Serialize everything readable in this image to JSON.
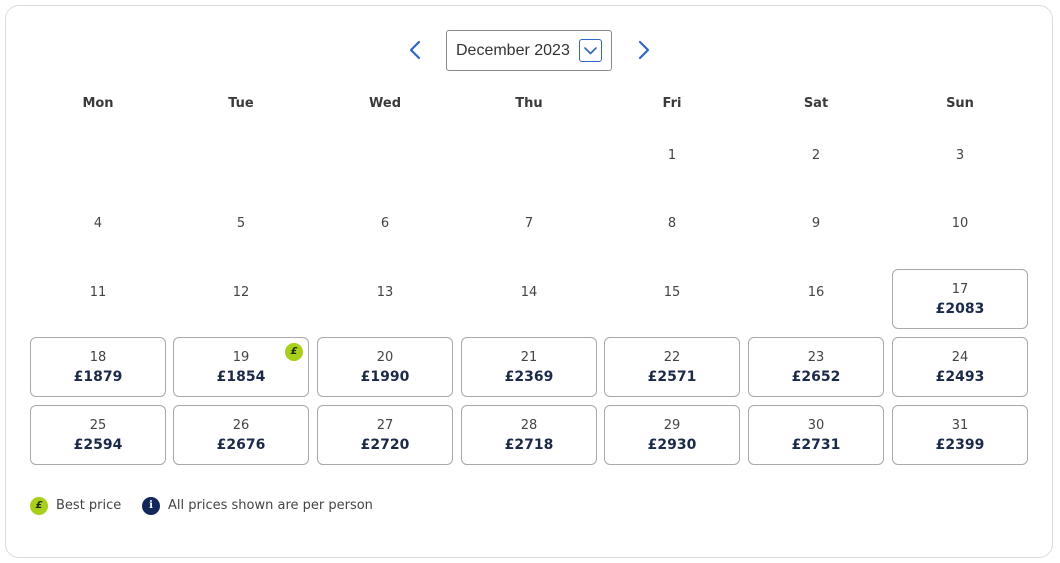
{
  "calendar": {
    "month_label": "December 2023",
    "weekdays": [
      "Mon",
      "Tue",
      "Wed",
      "Thu",
      "Fri",
      "Sat",
      "Sun"
    ],
    "days": [
      {
        "num": "1"
      },
      {
        "num": "2"
      },
      {
        "num": "3"
      },
      {
        "num": "4"
      },
      {
        "num": "5"
      },
      {
        "num": "6"
      },
      {
        "num": "7"
      },
      {
        "num": "8"
      },
      {
        "num": "9"
      },
      {
        "num": "10"
      },
      {
        "num": "11"
      },
      {
        "num": "12"
      },
      {
        "num": "13"
      },
      {
        "num": "14"
      },
      {
        "num": "15"
      },
      {
        "num": "16"
      },
      {
        "num": "17",
        "price": "£2083"
      },
      {
        "num": "18",
        "price": "£1879"
      },
      {
        "num": "19",
        "price": "£1854",
        "best": true
      },
      {
        "num": "20",
        "price": "£1990"
      },
      {
        "num": "21",
        "price": "£2369"
      },
      {
        "num": "22",
        "price": "£2571"
      },
      {
        "num": "23",
        "price": "£2652"
      },
      {
        "num": "24",
        "price": "£2493"
      },
      {
        "num": "25",
        "price": "£2594"
      },
      {
        "num": "26",
        "price": "£2676"
      },
      {
        "num": "27",
        "price": "£2720"
      },
      {
        "num": "28",
        "price": "£2718"
      },
      {
        "num": "29",
        "price": "£2930"
      },
      {
        "num": "30",
        "price": "£2731"
      },
      {
        "num": "31",
        "price": "£2399"
      }
    ],
    "badge_symbol": "£"
  },
  "legend": {
    "best_symbol": "£",
    "best_label": "Best price",
    "info_symbol": "i",
    "info_label": "All prices shown are per person"
  },
  "colors": {
    "accent": "#2f66c7",
    "best_badge": "#a8cf1a",
    "info_badge": "#13285a",
    "price_text": "#1c2a4a"
  },
  "icons": {
    "prev": "chevron-left-icon",
    "next": "chevron-right-icon",
    "dropdown": "chevron-down-icon"
  }
}
